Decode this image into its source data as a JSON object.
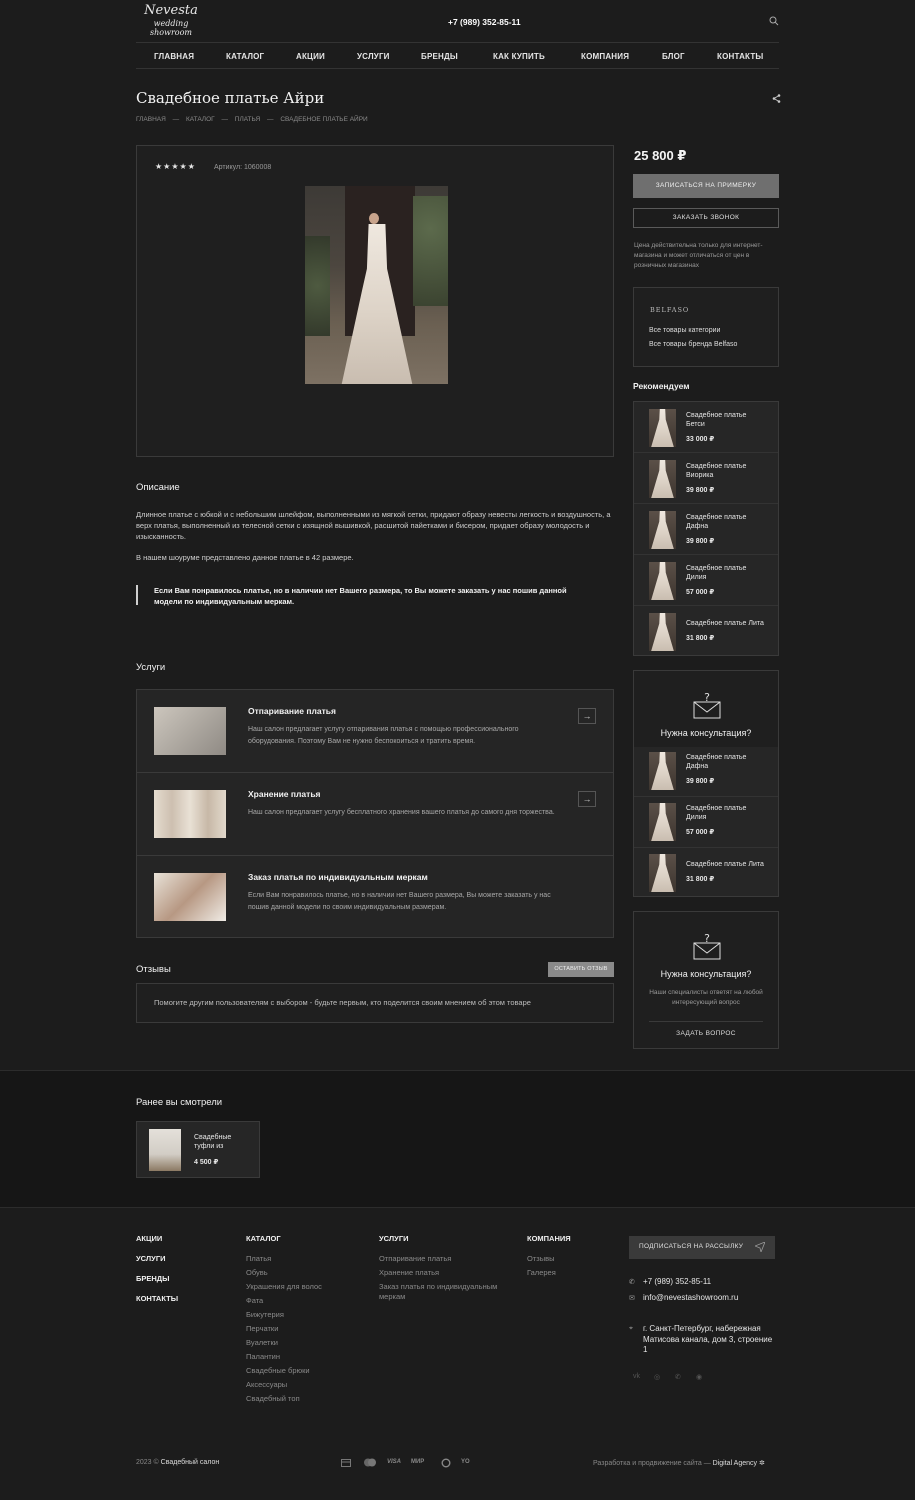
{
  "header": {
    "logo_title": "Nevesta",
    "logo_subtitle": "wedding showroom",
    "phone": "+7 (989) 352-85-11",
    "nav": [
      "ГЛАВНАЯ",
      "КАТАЛОГ",
      "АКЦИИ",
      "УСЛУГИ",
      "БРЕНДЫ",
      "КАК КУПИТЬ",
      "КОМПАНИЯ",
      "БЛОГ",
      "КОНТАКТЫ"
    ]
  },
  "page": {
    "title": "Свадебное платье Айри",
    "breadcrumb": [
      "ГЛАВНАЯ",
      "КАТАЛОГ",
      "ПЛАТЬЯ",
      "СВАДЕБНОЕ ПЛАТЬЕ АЙРИ"
    ],
    "breadcrumb_sep": "—"
  },
  "product": {
    "stars": "★★★★★",
    "rating": 5,
    "sku": "Артикул: 1060008",
    "price": "25 800 ₽",
    "btn_fitting": "ЗАПИСАТЬСЯ НА ПРИМЕРКУ",
    "btn_call": "ЗАКАЗАТЬ ЗВОНОК",
    "price_note": "Цена действительна только для интернет-магазина и может отличаться от цен в розничных магазинах"
  },
  "brand_box": {
    "brand_logo": "BELFASO",
    "link_category": "Все товары категории",
    "link_brand": "Все товары бренда Belfaso"
  },
  "description": {
    "heading": "Описание",
    "p1": "Длинное платье с юбкой и с небольшим шлейфом, выполненными из мягкой сетки, придают образу невесты легкость и воздушность, а верх платья, выполненный из телесной сетки с изящной вышивкой, расшитой пайетками и бисером, придает образу молодость и изысканность.",
    "p2": "В нашем шоуруме представлено данное платье в 42 размере.",
    "quote": "Если Вам понравилось платье, но в наличии нет Вашего размера, то Вы можете заказать у нас пошив данной модели по индивидуальным меркам."
  },
  "services": {
    "heading": "Услуги",
    "items": [
      {
        "title": "Отпаривание платья",
        "text": "Наш салон предлагает услугу отпаривания платья с помощью профессионального оборудования. Поэтому Вам не нужно беспокоиться и тратить время."
      },
      {
        "title": "Хранение платья",
        "text": "Наш салон предлагает услугу бесплатного хранения вашего платья до самого дня торжества."
      },
      {
        "title": "Заказ платья по индивидуальным меркам",
        "text": "Если Вам понравилось платье, но в наличии нет Вашего размера, Вы можете заказать у нас пошив данной модели по своим индивидуальным размерам."
      }
    ]
  },
  "reviews": {
    "heading": "Отзывы",
    "button": "ОСТАВИТЬ ОТЗЫВ",
    "empty_text": "Помогите другим пользователям с выбором - будьте первым, кто поделится своим мнением об этом товаре"
  },
  "recommend": {
    "heading": "Рекомендуем",
    "items": [
      {
        "name": "Свадебное платье Бетси",
        "price": "33 000 ₽"
      },
      {
        "name": "Свадебное платье Виорика",
        "price": "39 800 ₽"
      },
      {
        "name": "Свадебное платье Дафна",
        "price": "39 800 ₽"
      },
      {
        "name": "Свадебное платье Дилия",
        "price": "57 000 ₽"
      },
      {
        "name": "Свадебное платье Лита",
        "price": "31 800 ₽"
      }
    ]
  },
  "consult_overlay": {
    "heading": "Нужна консультация?",
    "items": [
      {
        "name": "Свадебное платье Дафна",
        "price": "39 800 ₽"
      },
      {
        "name": "Свадебное платье Дилия",
        "price": "57 000 ₽"
      },
      {
        "name": "Свадебное платье Лита",
        "price": "31 800 ₽"
      }
    ]
  },
  "consult": {
    "heading": "Нужна консультация?",
    "text": "Наши специалисты ответят на любой интересующий вопрос",
    "button": "ЗАДАТЬ ВОПРОС"
  },
  "viewed": {
    "heading": "Ранее вы смотрели",
    "item_name": "Свадебные туфли из",
    "item_price": "4 500 ₽"
  },
  "footer": {
    "col1": [
      "АКЦИИ",
      "УСЛУГИ",
      "БРЕНДЫ",
      "КОНТАКТЫ"
    ],
    "catalog_head": "КАТАЛОГ",
    "catalog": [
      "Платья",
      "Обувь",
      "Украшения для волос",
      "Фата",
      "Бижутерия",
      "Перчатки",
      "Вуалетки",
      "Палантин",
      "Свадебные брюки",
      "Аксессуары",
      "Свадебный топ"
    ],
    "services_head": "УСЛУГИ",
    "services": [
      "Отпаривание платья",
      "Хранение платья",
      "Заказ платья по индивидуальным меркам"
    ],
    "company_head": "КОМПАНИЯ",
    "company": [
      "Отзывы",
      "Галерея"
    ],
    "subscribe": "ПОДПИСАТЬСЯ НА РАССЫЛКУ",
    "phone": "+7 (989) 352-85-11",
    "email": "info@nevestashowroom.ru",
    "address": "г. Санкт-Петербург, набережная Матисова канала, дом 3, строение 1",
    "copyright_year": "2023 ©",
    "copyright_name": "Свадебный салон",
    "payments": [
      "МИР",
      "VISA",
      "MC",
      "СБП",
      "ЮMoney",
      "Pay"
    ],
    "dev_text": "Разработка и продвижение сайта —",
    "dev_name": "Digital Agency"
  }
}
